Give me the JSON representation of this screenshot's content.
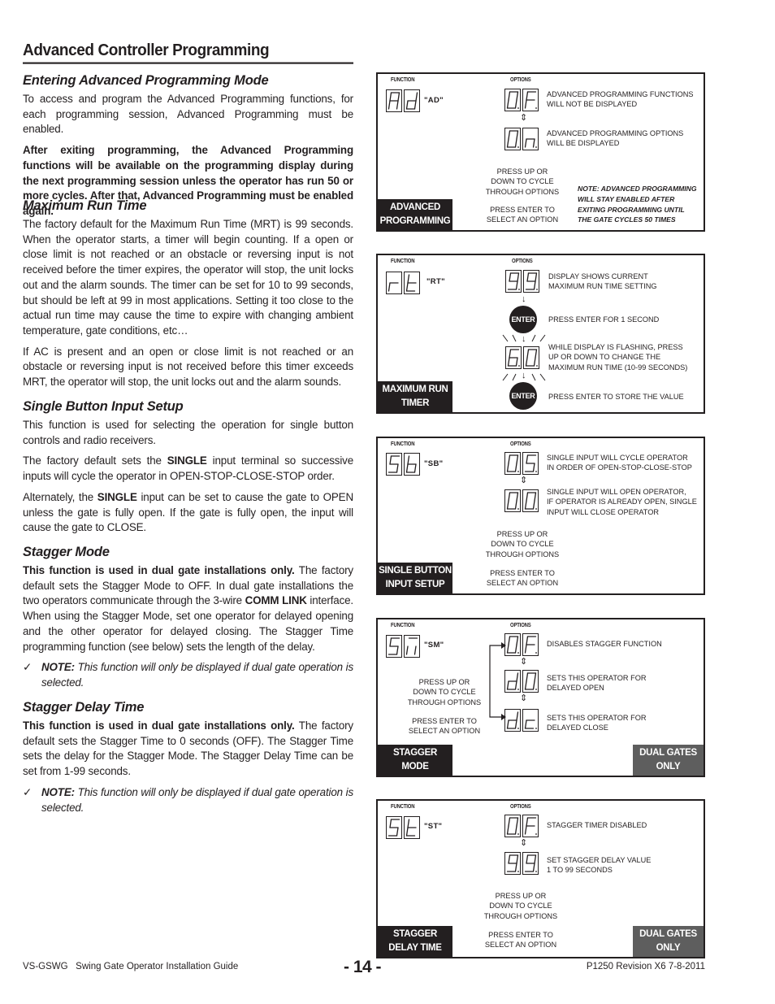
{
  "page_title": "Advanced Controller Programming",
  "sections": {
    "entering": {
      "heading": "Entering Advanced Programming Mode",
      "p1": "To access and program the Advanced Programming functions, for each programming session, Advanced Programming must be enabled.",
      "p2_bold": "After exiting programming, the Advanced Programming functions will be available on the programming display during the next programming session unless the operator has run 50 or more cycles. After that, Advanced Programming must be enabled again."
    },
    "mrt": {
      "heading": "Maximum Run Time",
      "p1": "The factory default for the Maximum Run Time (MRT) is 99 seconds. When the operator starts, a timer will begin counting. If a open or close limit is not reached or an obstacle or reversing input is not received before the timer expires, the operator will stop, the unit locks out and the alarm sounds. The timer can be set for 10 to 99 seconds, but should be left at 99 in most applications. Setting it too close to the actual run time may cause the time to expire with changing ambient temperature, gate conditions, etc…",
      "p2": "If AC is present and an open or close limit is not reached or an obstacle or reversing input is not received before this timer exceeds MRT, the operator will stop, the unit locks out and the alarm sounds."
    },
    "single": {
      "heading": "Single Button Input Setup",
      "p1": "This function is used for selecting the operation for single button controls and radio receivers.",
      "p2_a": "The factory default sets the ",
      "p2_b": "SINGLE",
      "p2_c": " input terminal so successive inputs will cycle the operator in OPEN-STOP-CLOSE-STOP order.",
      "p3_a": "Alternately, the ",
      "p3_b": "SINGLE",
      "p3_c": " input can be set to cause the gate to OPEN unless the gate is fully open. If the gate is fully open, the input will cause the gate to CLOSE."
    },
    "stagger": {
      "heading": "Stagger Mode",
      "p1_bold": "This function is used in dual gate installations only.",
      "p1_a": " The factory default sets the Stagger Mode to OFF. In dual gate installations the two operators communicate through the 3-wire ",
      "p1_b": "COMM LINK",
      "p1_c": " interface. When using the Stagger Mode, set one operator for delayed opening and the other operator for delayed closing. The Stagger Time programming function (see below) sets the length of the delay.",
      "note_label": "NOTE:",
      "note_text": " This function will only be displayed if dual gate operation is selected.",
      "check": "✓"
    },
    "delay": {
      "heading": "Stagger Delay Time",
      "p1_bold": "This function is used in dual gate installations only.",
      "p1_a": " The factory default sets the Stagger Time to 0 seconds (OFF). The Stagger Time sets the delay for the Stagger Mode. The Stagger Delay Time can be set from 1-99 seconds.",
      "note_label": "NOTE:",
      "note_text": " This function will only be displayed if dual gate operation is selected.",
      "check": "✓"
    }
  },
  "panels": {
    "function_label": "FUNCTION",
    "options_label": "OPTIONS",
    "cycle_text": [
      "PRESS UP OR",
      "DOWN TO CYCLE",
      "THROUGH OPTIONS"
    ],
    "select_text": [
      "PRESS ENTER TO",
      "SELECT AN OPTION"
    ],
    "dual_gates": [
      "DUAL GATES",
      "ONLY"
    ],
    "ad": {
      "code": "\"AD\"",
      "function_display": "Ad",
      "tag": [
        "ADVANCED",
        "PROGRAMMING"
      ],
      "options": [
        {
          "display": "0.F.",
          "desc": [
            "ADVANCED PROGRAMMING FUNCTIONS",
            "WILL NOT BE DISPLAYED"
          ]
        },
        {
          "display": "0.n.",
          "desc": [
            "ADVANCED PROGRAMMING OPTIONS",
            "WILL BE DISPLAYED"
          ]
        }
      ],
      "note": [
        "NOTE: ADVANCED PROGRAMMING",
        "WILL STAY ENABLED AFTER",
        "EXITING PROGRAMMING UNTIL",
        "THE GATE CYCLES 50 TIMES"
      ]
    },
    "rt": {
      "code": "\"RT\"",
      "function_display": "rt",
      "tag": [
        "MAXIMUM RUN",
        "TIMER"
      ],
      "enter_label": "ENTER",
      "steps": [
        {
          "display": "9.9.",
          "desc": [
            "DISPLAY SHOWS CURRENT",
            "MAXIMUM RUN TIME SETTING"
          ]
        },
        {
          "desc": [
            "PRESS ENTER FOR 1 SECOND"
          ]
        },
        {
          "display": "6.0.",
          "desc": [
            "WHILE DISPLAY IS FLASHING, PRESS",
            "UP OR DOWN TO CHANGE THE",
            "MAXIMUM RUN TIME (10-99 SECONDS)"
          ]
        },
        {
          "desc": [
            "PRESS ENTER TO STORE THE VALUE"
          ]
        }
      ]
    },
    "sb": {
      "code": "\"SB\"",
      "function_display": "Sb",
      "tag": [
        "SINGLE BUTTON",
        "INPUT SETUP"
      ],
      "options": [
        {
          "display": "0.S.",
          "desc": [
            "SINGLE INPUT WILL CYCLE OPERATOR",
            "IN ORDER OF OPEN-STOP-CLOSE-STOP"
          ]
        },
        {
          "display": "0.0.",
          "desc": [
            "SINGLE INPUT WILL OPEN OPERATOR,",
            "IF OPERATOR IS ALREADY OPEN, SINGLE",
            "INPUT WILL CLOSE OPERATOR"
          ]
        }
      ]
    },
    "sm": {
      "code": "\"SM\"",
      "function_display": "Sm",
      "tag": [
        "STAGGER",
        "MODE"
      ],
      "options": [
        {
          "display": "0.F.",
          "desc": [
            "DISABLES STAGGER FUNCTION"
          ]
        },
        {
          "display": "d.0.",
          "desc": [
            "SETS THIS OPERATOR FOR",
            "DELAYED OPEN"
          ]
        },
        {
          "display": "d.c.",
          "desc": [
            "SETS THIS OPERATOR FOR",
            "DELAYED CLOSE"
          ]
        }
      ]
    },
    "st": {
      "code": "\"ST\"",
      "function_display": "St",
      "tag": [
        "STAGGER",
        "DELAY TIME"
      ],
      "options": [
        {
          "display": "0.F.",
          "desc": [
            "STAGGER TIMER DISABLED"
          ]
        },
        {
          "display": "9.9.",
          "desc": [
            "SET STAGGER DELAY VALUE",
            "1 TO 99 SECONDS"
          ]
        }
      ]
    }
  },
  "footer": {
    "left": "VS-GSWG   Swing Gate Operator Installation Guide",
    "page": "- 14 -",
    "right": "P1250 Revision X6 7-8-2011"
  }
}
